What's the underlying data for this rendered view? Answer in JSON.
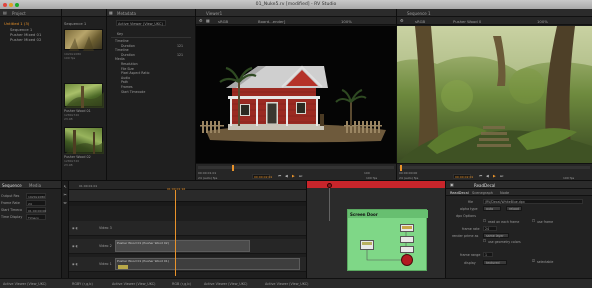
{
  "window": {
    "title": "01_Nuke5.rv [modified] - RV Studio"
  },
  "project_panel": {
    "tab_label": "Project",
    "items": [
      "Untitled 1 (3)",
      "Sequence 1",
      "Pusher Mixed 01",
      "Pusher Mixed 02"
    ],
    "thumbs": [
      {
        "name": "Sequence 1",
        "info": [
          "1920x1080",
          "100 fps",
          "03:00"
        ]
      },
      {
        "name": "Pusher Wood 01",
        "info": [
          "1280x720",
          "23.98",
          "4:15"
        ]
      },
      {
        "name": "Pusher Wood 02",
        "info": [
          "1280x720",
          "23.98",
          "4:15"
        ]
      }
    ]
  },
  "metadata_panel": {
    "tab_label": "Metadata",
    "viewer_select": "Active Viewer (View_UKC)",
    "key_header": "Key",
    "rows": [
      {
        "key": "Timeline",
        "value": ""
      },
      {
        "key": "Duration",
        "value": "121"
      },
      {
        "key": "Timeline",
        "value": ""
      },
      {
        "key": "Duration",
        "value": "121"
      },
      {
        "key": "Media",
        "value": ""
      },
      {
        "key": "Resolution",
        "value": ""
      },
      {
        "key": "File Size",
        "value": ""
      },
      {
        "key": "Pixel Aspect Ratio",
        "value": ""
      },
      {
        "key": "Audio",
        "value": ""
      },
      {
        "key": "Path",
        "value": ""
      },
      {
        "key": "Frames",
        "value": ""
      },
      {
        "key": "Start Timecode",
        "value": ""
      }
    ]
  },
  "viewer1": {
    "tab_label": "Viewer1",
    "toolbar": {
      "channel": "sRGB",
      "source": "Board...ender]",
      "zoom": "100%"
    },
    "timecode_start": "00:00:01:01",
    "timecode_cur": "00:00:02:01",
    "frame_end": "100",
    "fps": "24 (auto) fps",
    "rate": "100 fps"
  },
  "viewer2": {
    "tab_label": "Sequence 1",
    "toolbar": {
      "channel": "sRGB",
      "source": "Pusher Wood 0",
      "zoom": "100%"
    },
    "timecode_start": "00:00:00:00",
    "timecode_cur": "00:00:02:01",
    "fps": "24 (auto) fps",
    "rate": "100 fps"
  },
  "sequence_panel": {
    "tabs": [
      "Sequence",
      "Media"
    ],
    "timecode": "01:00:01:01",
    "ruler_mark": "01:00:01:16",
    "properties": [
      {
        "label": "Output Res",
        "value": "1920x1080"
      },
      {
        "label": "Frame Rate",
        "value": "24"
      },
      {
        "label": "Start Timeco",
        "value": "01:00:00:00"
      },
      {
        "label": "Time Display",
        "value": "Timeco"
      }
    ],
    "tracks": [
      {
        "name": "Video 3",
        "clip": ""
      },
      {
        "name": "Video 2",
        "clip": "Pusher Wood 01 (Pusher Wood 02)"
      },
      {
        "name": "Video 1",
        "clip": "Pusher Wood 01 (Pusher Wood 01)"
      }
    ]
  },
  "node_graph": {
    "tabs": [
      "ReadDefault",
      "Scenegraph",
      "Node"
    ],
    "group_title": "Screen Door"
  },
  "node_panel": {
    "header": "ReadDecal",
    "tabs": [
      "ReadDecal",
      "Scenegraph",
      "Node"
    ],
    "file_path": "/RV/Decal/WhiteBlue.dpx",
    "properties": [
      {
        "label": "file",
        "value": "/RV/Decal/WhiteBlue.dpx"
      },
      {
        "label": "alpha type",
        "value": "auto"
      },
      {
        "label": "dpx Options",
        "value": ""
      },
      {
        "label": "frame rate",
        "value": "24"
      },
      {
        "label": "render prime as",
        "value": "same layer"
      },
      {
        "label": "frame range",
        "value": "1"
      },
      {
        "label": "display",
        "value": "textured"
      }
    ],
    "checks": [
      "read on each frame",
      "use frame",
      "use geometry colors",
      "selectable"
    ],
    "buttons": [
      "auto",
      "reload"
    ]
  },
  "bottom_bar": {
    "items": [
      "Active Viewer (View_UKC)",
      "RGBY (r,g,b)",
      "Active Viewer (View_UKC)",
      "RGB (r,g,b)",
      "Active Viewer (View_UKC)",
      "Active Viewer (View_UKC)"
    ]
  },
  "colors": {
    "accent": "#e8922a",
    "playhead": "#c8252b",
    "node_bg": "#7fd787"
  }
}
